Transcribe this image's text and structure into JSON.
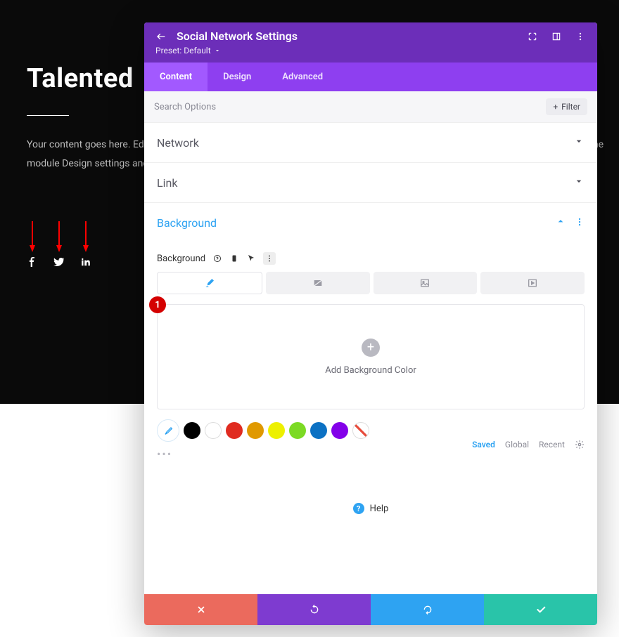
{
  "page": {
    "title": "Talented",
    "text_line1": "Your content goes here. Edi",
    "text_line2": "the",
    "text_line3": "module Design settings and"
  },
  "annotation": {
    "step": "1"
  },
  "panel": {
    "title": "Social Network Settings",
    "preset": "Preset: Default",
    "tabs": [
      "Content",
      "Design",
      "Advanced"
    ],
    "search_placeholder": "Search Options",
    "filter_label": "Filter",
    "sections": {
      "network": "Network",
      "link": "Link",
      "background": "Background"
    },
    "bg_field": "Background",
    "bg_add": "Add Background Color",
    "palette_meta": {
      "saved": "Saved",
      "global": "Global",
      "recent": "Recent"
    },
    "help": "Help",
    "swatches": [
      "#000000",
      "#ffffff",
      "#e02b20",
      "#e09900",
      "#edf000",
      "#7cda24",
      "#0c71c3",
      "#8300e9"
    ]
  }
}
